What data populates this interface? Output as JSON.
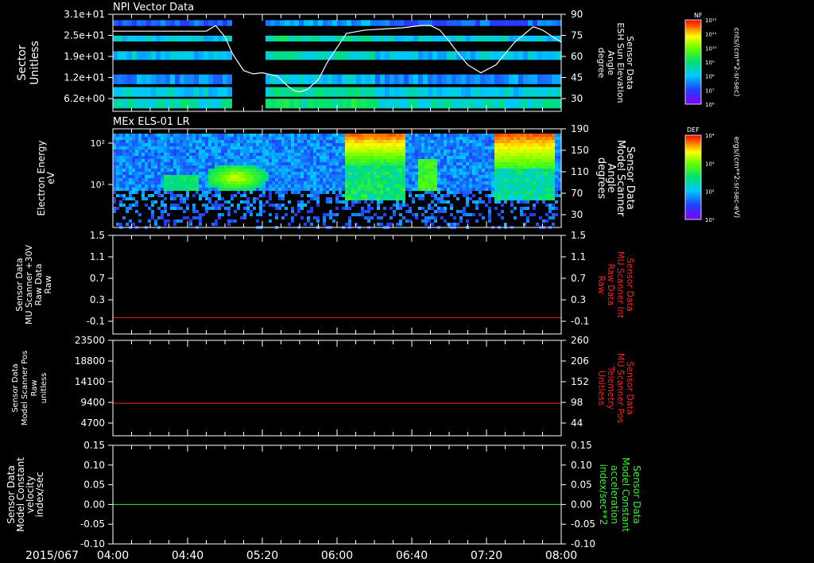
{
  "date_label": "2015/067",
  "time_ticks": [
    "04:00",
    "04:40",
    "05:20",
    "06:00",
    "06:40",
    "07:20",
    "08:00"
  ],
  "colors": {
    "red": "#ff2020",
    "green": "#20ff20",
    "white": "#ffffff",
    "black": "#000000"
  },
  "chart_data": [
    {
      "type": "heatmap",
      "title": "NPI Vector Data",
      "ylabel": [
        "Sector",
        "Unitless"
      ],
      "yticks": [
        "3.1e+01",
        "2.5e+01",
        "1.9e+01",
        "1.2e+01",
        "6.2e+00"
      ],
      "right_ylabel": [
        "Sensor Data",
        "ESH Sun Elevation",
        "Angle",
        "degree"
      ],
      "right_yticks": [
        "90",
        "75",
        "60",
        "45",
        "30"
      ],
      "colorbar": {
        "label": "NF",
        "units": "cnts/(cm**2-sr-sec)",
        "ticks": [
          "10¹²",
          "10¹¹",
          "10¹⁰",
          "10⁹",
          "10⁸",
          "10⁷",
          "10⁶"
        ]
      },
      "overlay_line": {
        "color": "white",
        "x_minutes": [
          0,
          50,
          55,
          60,
          64,
          70,
          75,
          80,
          88,
          93,
          97,
          100,
          104,
          110,
          115,
          125,
          135,
          145,
          155,
          160,
          165,
          170,
          175,
          180,
          185,
          190,
          197,
          205,
          215,
          225,
          230,
          240
        ],
        "y_degrees": [
          75,
          75,
          80,
          70,
          55,
          40,
          37,
          38,
          35,
          27,
          22,
          21,
          23,
          32,
          48,
          73,
          76,
          77,
          78,
          79,
          80,
          80,
          76,
          66,
          55,
          45,
          38,
          45,
          65,
          79,
          76,
          65
        ]
      }
    },
    {
      "type": "heatmap",
      "title": "MEx ELS-01 LR",
      "ylabel": [
        "Electron Energy",
        "eV"
      ],
      "yticks": [
        "10²",
        "10¹"
      ],
      "right_ylabel": [
        "Sensor Data",
        "Model Scanner",
        "Angle",
        "degrees"
      ],
      "right_yticks": [
        "190",
        "150",
        "110",
        "70",
        "30"
      ],
      "colorbar": {
        "label": "DEF",
        "units": "ergs/(cm**2-sr-sec-eV)",
        "ticks": [
          "10⁴",
          "10³",
          "10²",
          "10¹"
        ]
      }
    },
    {
      "type": "line",
      "ylabel": [
        "Sensor Data",
        "MU Scanner +30V",
        "Raw Data",
        "Raw"
      ],
      "yticks": [
        "1.5",
        "1.1",
        "0.7",
        "0.3",
        "-0.1"
      ],
      "right_ylabel": [
        "Sensor Data",
        "MU Scanner Int",
        "Raw Data",
        "Raw"
      ],
      "right_yticks": [
        "1.5",
        "1.1",
        "0.7",
        "0.3",
        "-0.1"
      ],
      "ylim": [
        -0.3,
        1.5
      ],
      "series": [
        {
          "color": "red",
          "x_minutes": [
            0,
            240
          ],
          "values": [
            0.0,
            0.0
          ]
        }
      ]
    },
    {
      "type": "line",
      "ylabel": [
        "Sensor Data",
        "Model Scanner Pos",
        "Raw",
        "unitless"
      ],
      "yticks": [
        "23500",
        "18800",
        "14100",
        "9400",
        "4700"
      ],
      "right_ylabel": [
        "Sensor Data",
        "MU Scanner Pos",
        "Telemetry",
        "Unitless"
      ],
      "right_yticks": [
        "260",
        "206",
        "152",
        "98",
        "44"
      ],
      "ylim": [
        0,
        23500
      ],
      "series": [
        {
          "color": "red",
          "x_minutes": [
            0,
            240
          ],
          "values": [
            8000,
            8000
          ]
        }
      ]
    },
    {
      "type": "line",
      "ylabel": [
        "Sensor Data",
        "Model Constant",
        "velocity",
        "index/sec"
      ],
      "yticks": [
        "0.15",
        "0.10",
        "0.05",
        "0.00",
        "-0.05",
        "-0.10"
      ],
      "right_ylabel": [
        "Sensor Data",
        "Model Constant",
        "acceleration",
        "index/sec**2"
      ],
      "right_yticks": [
        "0.15",
        "0.10",
        "0.05",
        "0.00",
        "-0.05",
        "-0.10"
      ],
      "ylim": [
        -0.1,
        0.15
      ],
      "series": [
        {
          "color": "green",
          "x_minutes": [
            0,
            240
          ],
          "values": [
            0.0,
            0.0
          ]
        }
      ]
    }
  ]
}
